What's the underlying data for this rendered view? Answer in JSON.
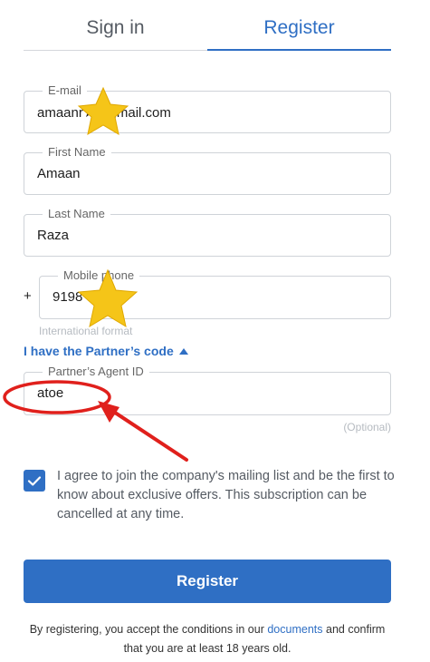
{
  "tabs": {
    "signin": "Sign in",
    "register": "Register"
  },
  "form": {
    "email": {
      "label": "E-mail",
      "value": "amaanr★@gmail.com"
    },
    "first_name": {
      "label": "First Name",
      "value": "Amaan"
    },
    "last_name": {
      "label": "Last Name",
      "value": "Raza"
    },
    "mobile": {
      "prefix": "+",
      "label": "Mobile phone",
      "value": "9198",
      "hint": "International format"
    },
    "partner_toggle": "I have the Partner’s code",
    "partner": {
      "label": "Partner’s Agent ID",
      "value": "atoe",
      "optional": "(Optional)"
    }
  },
  "consent": {
    "checked": true,
    "text": "I agree to join the company's mailing list and be the first to know about exclusive offers. This subscription can be cancelled at any time."
  },
  "register_button": "Register",
  "legal": {
    "before": "By registering, you accept the conditions in our ",
    "link": "documents",
    "after": " and confirm that you are at least 18 years old."
  },
  "colors": {
    "accent": "#2f6fc4",
    "annotation": "#e0201c",
    "star": "#f5c518"
  }
}
